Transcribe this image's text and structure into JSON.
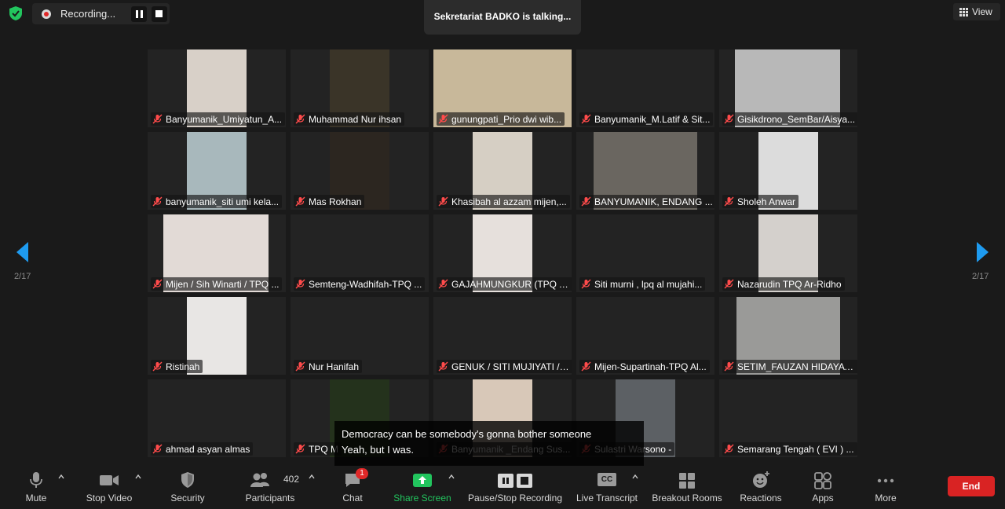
{
  "topbar": {
    "recording_label": "Recording...",
    "talking_label": "Sekretariat BADKO is talking...",
    "view_label": "View"
  },
  "pagination": {
    "left_page": "2/17",
    "right_page": "2/17"
  },
  "tiles": [
    {
      "name": "Banyumanik_Umiyatun_A...",
      "video": true,
      "bg": "#d8d0c8"
    },
    {
      "name": "Muhammad Nur ihsan",
      "video": true,
      "bg": "#3a3428"
    },
    {
      "name": "gunungpati_Prio dwi wib...",
      "video": true,
      "bg": "#c8b89a"
    },
    {
      "name": "Banyumanik_M.Latif & Sit...",
      "video": false,
      "bg": ""
    },
    {
      "name": "Gisikdrono_SemBar/Aisya...",
      "video": true,
      "bg": "#b8b8b8"
    },
    {
      "name": "banyumanik_siti umi kela...",
      "video": true,
      "bg": "#a8b8bc"
    },
    {
      "name": "Mas Rokhan",
      "video": true,
      "bg": "#2c2620"
    },
    {
      "name": "Khasibah al azzam mijen,...",
      "video": true,
      "bg": "#d6cfc4"
    },
    {
      "name": "BANYUMANIK, ENDANG ...",
      "video": true,
      "bg": "#6a6660"
    },
    {
      "name": "Sholeh Anwar",
      "video": true,
      "bg": "#dcdcdc"
    },
    {
      "name": "Mijen / Sih Winarti / TPQ ...",
      "video": true,
      "bg": "#e2dad6"
    },
    {
      "name": "Semteng-Wadhifah-TPQ ...",
      "video": false,
      "bg": ""
    },
    {
      "name": "GAJAHMUNGKUR (TPQ A...",
      "video": true,
      "bg": "#e6e0dc"
    },
    {
      "name": "Siti murni , lpq al mujahi...",
      "video": false,
      "bg": ""
    },
    {
      "name": "Nazarudin TPQ Ar-Ridho",
      "video": true,
      "bg": "#d4d0cc"
    },
    {
      "name": "Ristinah",
      "video": true,
      "bg": "#e8e6e4"
    },
    {
      "name": "Nur Hanifah",
      "video": false,
      "bg": ""
    },
    {
      "name": "GENUK / SITI MUJIYATI /L...",
      "video": false,
      "bg": ""
    },
    {
      "name": "Mijen-Supartinah-TPQ Al...",
      "video": false,
      "bg": ""
    },
    {
      "name": "SETIM_FAUZAN HIDAYAT...",
      "video": true,
      "bg": "#9a9a98"
    },
    {
      "name": "ahmad asyan almas",
      "video": false,
      "bg": ""
    },
    {
      "name": "TPQ M",
      "video": true,
      "bg": "#24321c"
    },
    {
      "name": "Banyumanik _Endang Sus...",
      "video": true,
      "bg": "#d8c8b8"
    },
    {
      "name": "Sulastri Warsono -",
      "video": true,
      "bg": "#5c6064"
    },
    {
      "name": "Semarang Tengah ( EVI ) ...",
      "video": false,
      "bg": ""
    }
  ],
  "captions": {
    "line1": "Democracy can be somebody's gonna bother someone",
    "line2": "Yeah, but I was."
  },
  "toolbar": {
    "mute": "Mute",
    "stop_video": "Stop Video",
    "security": "Security",
    "participants": "Participants",
    "participants_count": "402",
    "chat": "Chat",
    "chat_badge": "1",
    "share_screen": "Share Screen",
    "pause_stop_recording": "Pause/Stop Recording",
    "live_transcript": "Live Transcript",
    "cc_glyph": "CC",
    "breakout_rooms": "Breakout Rooms",
    "reactions": "Reactions",
    "apps": "Apps",
    "more": "More",
    "end": "End"
  },
  "colors": {
    "share_green": "#22c55e",
    "end_red": "#d92323",
    "accent_blue": "#1e9bf0"
  }
}
